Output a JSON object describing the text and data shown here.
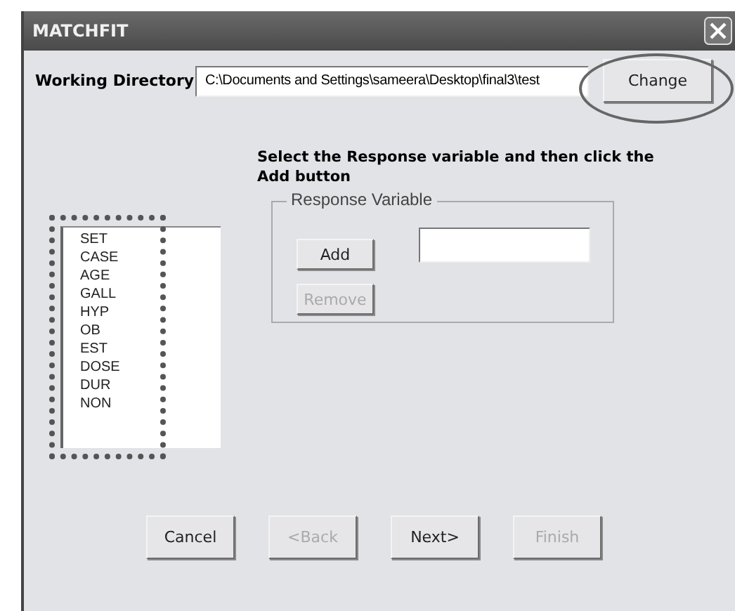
{
  "window": {
    "title": "MATCHFIT"
  },
  "working_directory": {
    "label": "Working Directory",
    "value": "C:\\Documents and Settings\\sameera\\Desktop\\final3\\test",
    "button": "Change",
    "highlighted": true
  },
  "instruction": "Select the Response variable and then click the Add button",
  "variables_highlighted": true,
  "variables": [
    "SET",
    "CASE",
    "AGE",
    "GALL",
    "HYP",
    "OB",
    "EST",
    "DOSE",
    "DUR",
    "NON"
  ],
  "response_group": {
    "title": "Response Variable",
    "buttons": [
      {
        "label": "Add",
        "disabled": false
      },
      {
        "label": "Remove",
        "disabled": true
      }
    ]
  },
  "nav_buttons": [
    {
      "label": "Cancel",
      "disabled": false
    },
    {
      "label": "<Back",
      "disabled": true
    },
    {
      "label": "Next>",
      "disabled": false
    },
    {
      "label": "Finish",
      "disabled": true
    }
  ]
}
